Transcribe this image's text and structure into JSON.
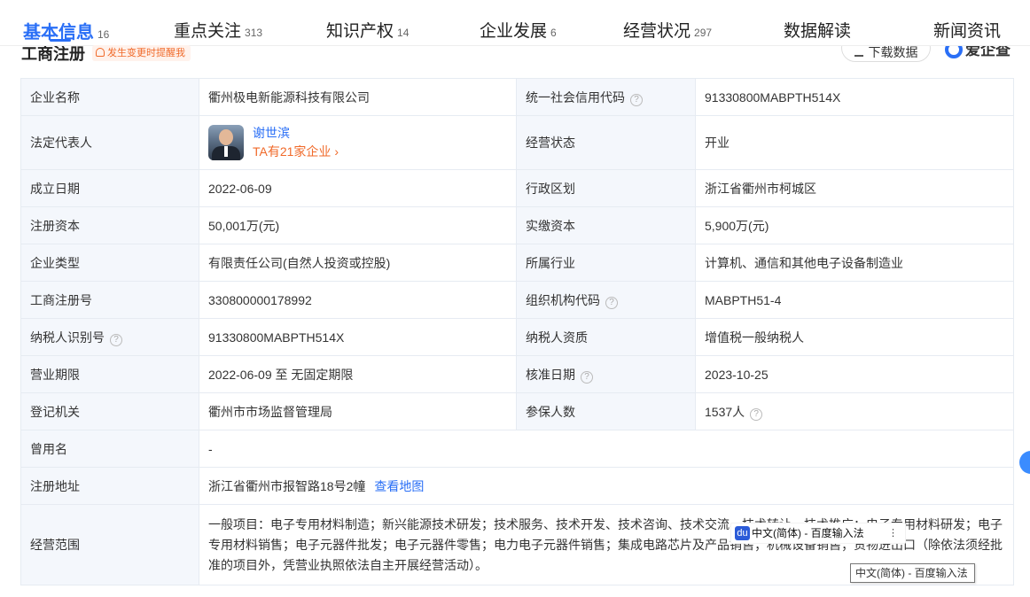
{
  "tabs": [
    {
      "label": "基本信息",
      "count": "16"
    },
    {
      "label": "重点关注",
      "count": "313"
    },
    {
      "label": "知识产权",
      "count": "14"
    },
    {
      "label": "企业发展",
      "count": "6"
    },
    {
      "label": "经营状况",
      "count": "297"
    },
    {
      "label": "数据解读",
      "count": ""
    },
    {
      "label": "新闻资讯",
      "count": ""
    }
  ],
  "section": {
    "title": "工商注册",
    "alert_chip": "发生变更时提醒我",
    "download_label": "下载数据",
    "brand": "爱企查"
  },
  "colors": {
    "accent": "#2a6ff6",
    "warning": "#f06a2a",
    "key_bg": "#f4f7fc",
    "border": "#e6ebf2"
  },
  "rows": {
    "r1": {
      "k1": "企业名称",
      "v1": "衢州极电新能源科技有限公司",
      "k2": "统一社会信用代码",
      "v2": "91330800MABPTH514X"
    },
    "r2": {
      "k1": "法定代表人",
      "person_name": "谢世滨",
      "person_more": "TA有21家企业",
      "k2": "经营状态",
      "v2": "开业"
    },
    "r3": {
      "k1": "成立日期",
      "v1": "2022-06-09",
      "k2": "行政区划",
      "v2": "浙江省衢州市柯城区"
    },
    "r4": {
      "k1": "注册资本",
      "v1": "50,001万(元)",
      "k2": "实缴资本",
      "v2": "5,900万(元)"
    },
    "r5": {
      "k1": "企业类型",
      "v1": "有限责任公司(自然人投资或控股)",
      "k2": "所属行业",
      "v2": "计算机、通信和其他电子设备制造业"
    },
    "r6": {
      "k1": "工商注册号",
      "v1": "330800000178992",
      "k2": "组织机构代码",
      "v2": "MABPTH51-4"
    },
    "r7": {
      "k1": "纳税人识别号",
      "v1": "91330800MABPTH514X",
      "k2": "纳税人资质",
      "v2": "增值税一般纳税人"
    },
    "r8": {
      "k1": "营业期限",
      "v1": "2022-06-09 至 无固定期限",
      "k2": "核准日期",
      "v2": "2023-10-25"
    },
    "r9": {
      "k1": "登记机关",
      "v1": "衢州市市场监督管理局",
      "k2": "参保人数",
      "v2": "1537人"
    },
    "r10": {
      "k1": "曾用名",
      "v1": "-"
    },
    "r11": {
      "k1": "注册地址",
      "v1": "浙江省衢州市报智路18号2幢",
      "link": "查看地图"
    },
    "r12": {
      "k1": "经营范围",
      "v1": "一般项目：电子专用材料制造；新兴能源技术研发；技术服务、技术开发、技术咨询、技术交流、技术转让、技术推广；电子专用材料研发；电子专用材料销售；电子元器件批发；电子元器件零售；电力电子元器件销售；集成电路芯片及产品销售；机械设备销售；货物进出口（除依法须经批准的项目外，凭营业执照依法自主开展经营活动）。"
    }
  },
  "ime": {
    "logo": "du",
    "bar_label": "中文(简体) - 百度输入法",
    "tooltip": "中文(简体) - 百度输入法"
  }
}
